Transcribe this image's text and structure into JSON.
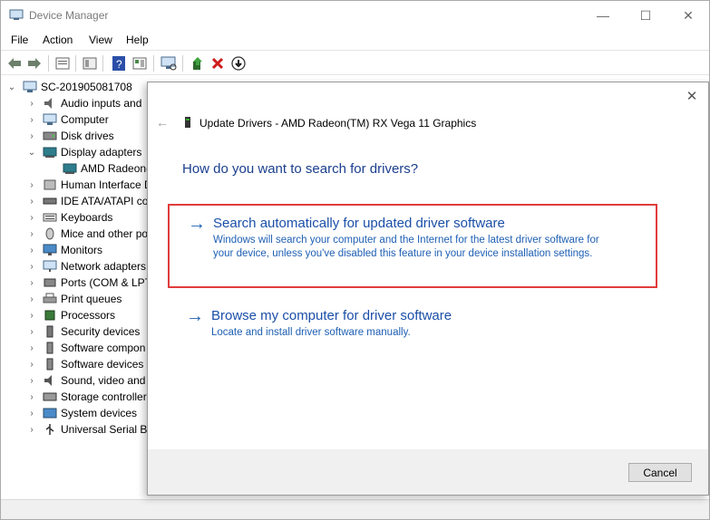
{
  "window": {
    "title": "Device Manager",
    "min_glyph": "—",
    "max_glyph": "☐",
    "close_glyph": "✕"
  },
  "menu": {
    "items": [
      "File",
      "Action",
      "View",
      "Help"
    ]
  },
  "toolbar": {
    "icons": [
      "back-icon",
      "forward-icon",
      "properties-icon",
      "show-hide-icon",
      "help-icon",
      "action-view-icon",
      "scan-hardware-icon",
      "update-driver-icon",
      "uninstall-icon",
      "disable-icon"
    ]
  },
  "tree": {
    "root": "SC-201905081708",
    "items": [
      {
        "label": "Audio inputs and",
        "expanded": false,
        "icon": "audio-icon"
      },
      {
        "label": "Computer",
        "expanded": false,
        "icon": "computer-icon"
      },
      {
        "label": "Disk drives",
        "expanded": false,
        "icon": "disk-icon"
      },
      {
        "label": "Display adapters",
        "expanded": true,
        "icon": "display-adapter-icon"
      },
      {
        "label": "AMD Radeon(",
        "child": true,
        "icon": "display-adapter-icon"
      },
      {
        "label": "Human Interface D",
        "expanded": false,
        "icon": "hid-icon"
      },
      {
        "label": "IDE ATA/ATAPI co",
        "expanded": false,
        "icon": "ide-icon"
      },
      {
        "label": "Keyboards",
        "expanded": false,
        "icon": "keyboard-icon"
      },
      {
        "label": "Mice and other po",
        "expanded": false,
        "icon": "mouse-icon"
      },
      {
        "label": "Monitors",
        "expanded": false,
        "icon": "monitor-icon"
      },
      {
        "label": "Network adapters",
        "expanded": false,
        "icon": "network-icon"
      },
      {
        "label": "Ports (COM & LPT",
        "expanded": false,
        "icon": "port-icon"
      },
      {
        "label": "Print queues",
        "expanded": false,
        "icon": "printer-icon"
      },
      {
        "label": "Processors",
        "expanded": false,
        "icon": "processor-icon"
      },
      {
        "label": "Security devices",
        "expanded": false,
        "icon": "security-icon"
      },
      {
        "label": "Software compon",
        "expanded": false,
        "icon": "software-component-icon"
      },
      {
        "label": "Software devices",
        "expanded": false,
        "icon": "software-device-icon"
      },
      {
        "label": "Sound, video and",
        "expanded": false,
        "icon": "sound-icon"
      },
      {
        "label": "Storage controller",
        "expanded": false,
        "icon": "storage-icon"
      },
      {
        "label": "System devices",
        "expanded": false,
        "icon": "system-icon"
      },
      {
        "label": "Universal Serial Bu",
        "expanded": false,
        "icon": "usb-icon"
      }
    ]
  },
  "dialog": {
    "title": "Update Drivers - AMD Radeon(TM) RX Vega 11 Graphics",
    "question": "How do you want to search for drivers?",
    "options": [
      {
        "arrow": "→",
        "title": "Search automatically for updated driver software",
        "description": "Windows will search your computer and the Internet for the latest driver software for your device, unless you've disabled this feature in your device installation settings."
      },
      {
        "arrow": "→",
        "title": "Browse my computer for driver software",
        "description": "Locate and install driver software manually."
      }
    ],
    "cancel_label": "Cancel",
    "close_glyph": "✕",
    "back_glyph": "←"
  },
  "colors": {
    "accent_blue": "#1e5fb4",
    "heading_blue": "#1b3f8f",
    "highlight_red": "#e03c3c"
  }
}
